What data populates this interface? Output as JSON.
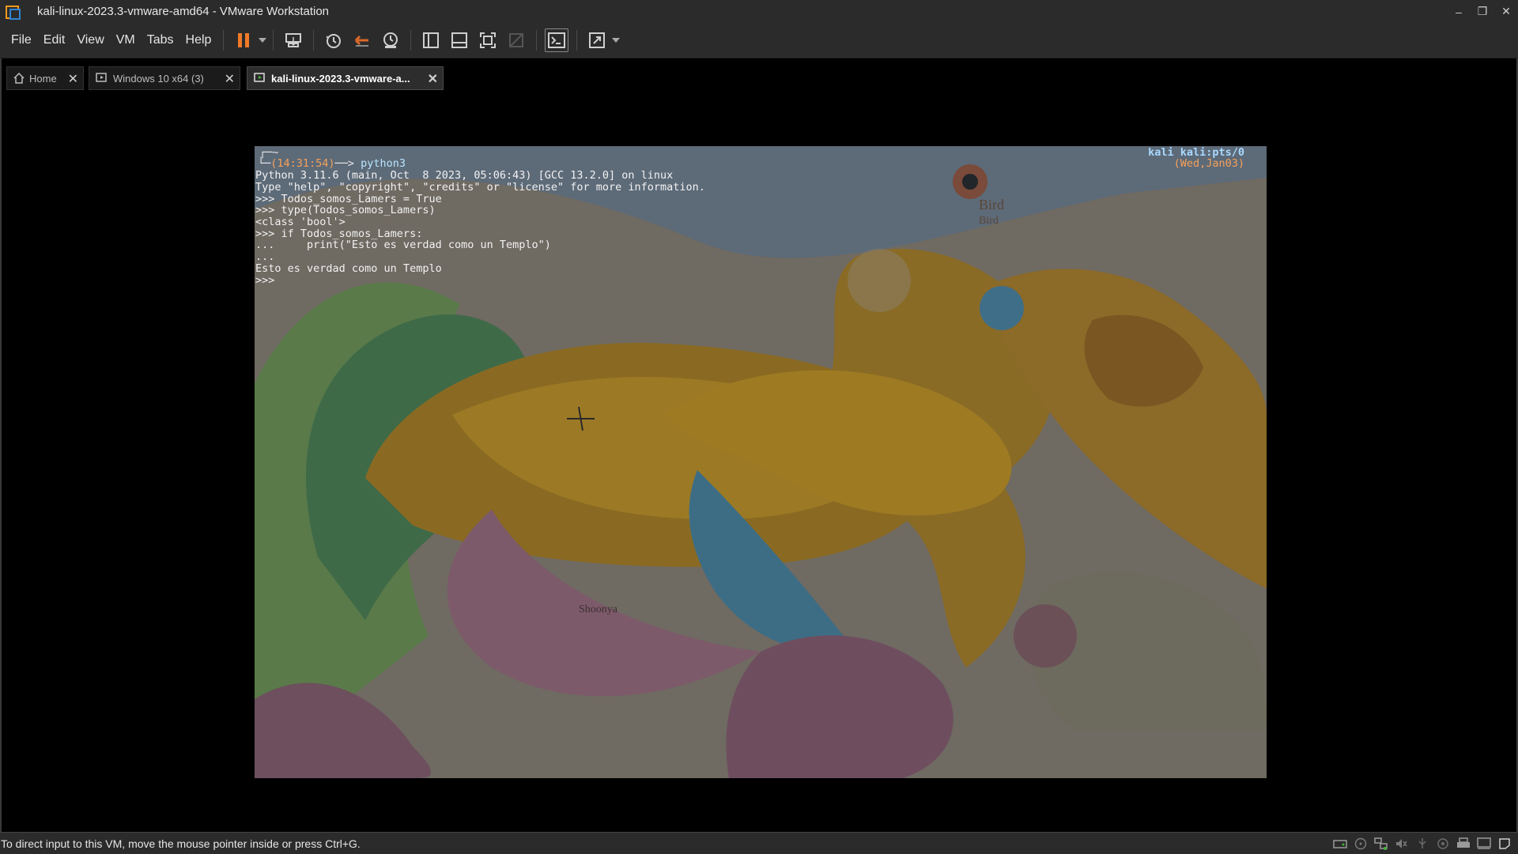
{
  "window": {
    "title": "kali-linux-2023.3-vmware-amd64 - VMware Workstation",
    "minimize_glyph": "–",
    "restore_glyph": "❐",
    "close_glyph": "✕"
  },
  "menu": {
    "file": "File",
    "edit": "Edit",
    "view": "View",
    "vm": "VM",
    "tabs": "Tabs",
    "help": "Help"
  },
  "toolbar": {
    "icons": [
      "pause-icon",
      "send-ctrl-alt-del-icon",
      "snapshot-icon",
      "revert-snapshot-icon",
      "snapshot-manager-icon",
      "sidebar-icon",
      "thumbnail-bar-icon",
      "full-screen-icon",
      "unity-icon",
      "console-view-icon",
      "stretch-guest-icon"
    ],
    "pause_color": "#f07a28"
  },
  "tabs": [
    {
      "label": "Home",
      "icon": "home-icon"
    },
    {
      "label": "Windows 10 x64 (3)",
      "icon": "vm-icon"
    },
    {
      "label": "kali-linux-2023.3-vmware-a...",
      "icon": "vm-running-icon",
      "active": true
    }
  ],
  "terminal": {
    "prompt_frame_top": "┌─",
    "prompt_home": "~",
    "prompt_frame_bottom": "└─",
    "prompt_time": "(14:31:54)",
    "prompt_arrow": "──> ",
    "prompt_cmd": "python3",
    "right_user": "kali kali:pts/0",
    "right_date": "(Wed,Jan03)",
    "lines": [
      "Python 3.11.6 (main, Oct  8 2023, 05:06:43) [GCC 13.2.0] on linux",
      "Type \"help\", \"copyright\", \"credits\" or \"license\" for more information.",
      ">>> Todos_somos_Lamers = True",
      ">>> type(Todos_somos_Lamers)",
      "<class 'bool'>",
      ">>> if Todos_somos_Lamers:",
      "...     print(\"Esto es verdad como un Templo\")",
      "...",
      "Esto es verdad como un Templo",
      ">>> "
    ],
    "wallpaper_text_1": "Bird",
    "wallpaper_text_2": "Bird",
    "wallpaper_text_3": "Shoonya"
  },
  "status": {
    "message": "To direct input to this VM, move the mouse pointer inside or press Ctrl+G.",
    "icons": [
      "hard-disk-icon",
      "cd-dvd-icon",
      "network-icon",
      "sound-icon",
      "usb-icon",
      "camera-icon",
      "printer-icon",
      "display-icon",
      "message-log-icon"
    ]
  },
  "colors": {
    "chrome_bg": "#2b2b2b",
    "accent_orange": "#f07a28",
    "prompt_orange": "#f6a15a",
    "prompt_blue": "#a8d8ff"
  }
}
